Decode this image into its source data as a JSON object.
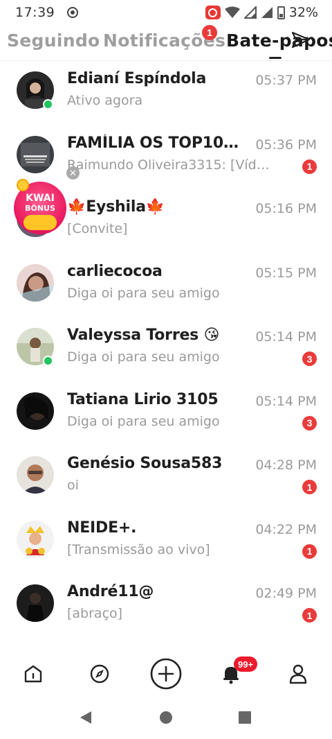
{
  "status_bar": {
    "time": "17:39",
    "battery": "32%"
  },
  "tabs": {
    "following": "Seguindo",
    "notifications": "Notificações",
    "notifications_badge": "1",
    "chats": "Bate-papos"
  },
  "promo": {
    "line1": "KWAI",
    "line2": "BÔNUS"
  },
  "chats": [
    {
      "name": "Edianí Espíndola",
      "preview": "Ativo agora",
      "time": "05:37 PM",
      "unread": "",
      "online": true
    },
    {
      "name": "FAMÍLIA OS TOP10 D...",
      "preview": "Raimundo Oliveira3315: [Vídeo]",
      "time": "05:36 PM",
      "unread": "1",
      "online": false
    },
    {
      "name": "🍁Eyshila🍁",
      "preview": "[Convite]",
      "time": "05:16 PM",
      "unread": "",
      "online": false
    },
    {
      "name": "carliecocoa",
      "preview": "Diga oi para seu amigo",
      "time": "05:15 PM",
      "unread": "",
      "online": false
    },
    {
      "name": "Valeyssa Torres 😘",
      "preview": "Diga oi para seu amigo",
      "time": "05:14 PM",
      "unread": "3",
      "online": true
    },
    {
      "name": "Tatiana Lirio 3105",
      "preview": "Diga oi para seu amigo",
      "time": "05:14 PM",
      "unread": "3",
      "online": false
    },
    {
      "name": "Genésio Sousa583",
      "preview": "oi",
      "time": "04:28 PM",
      "unread": "1",
      "online": false
    },
    {
      "name": "NEIDE+.",
      "preview": "[Transmissão ao vivo]",
      "time": "04:22 PM",
      "unread": "1",
      "online": false
    },
    {
      "name": "André11@",
      "preview": "[abraço]",
      "time": "02:49 PM",
      "unread": "1",
      "online": false
    }
  ],
  "bottom_nav": {
    "notifications_badge": "99+"
  },
  "colors": {
    "badge": "#ea3b3b",
    "online": "#22c55e",
    "muted": "#9a9a9a"
  }
}
